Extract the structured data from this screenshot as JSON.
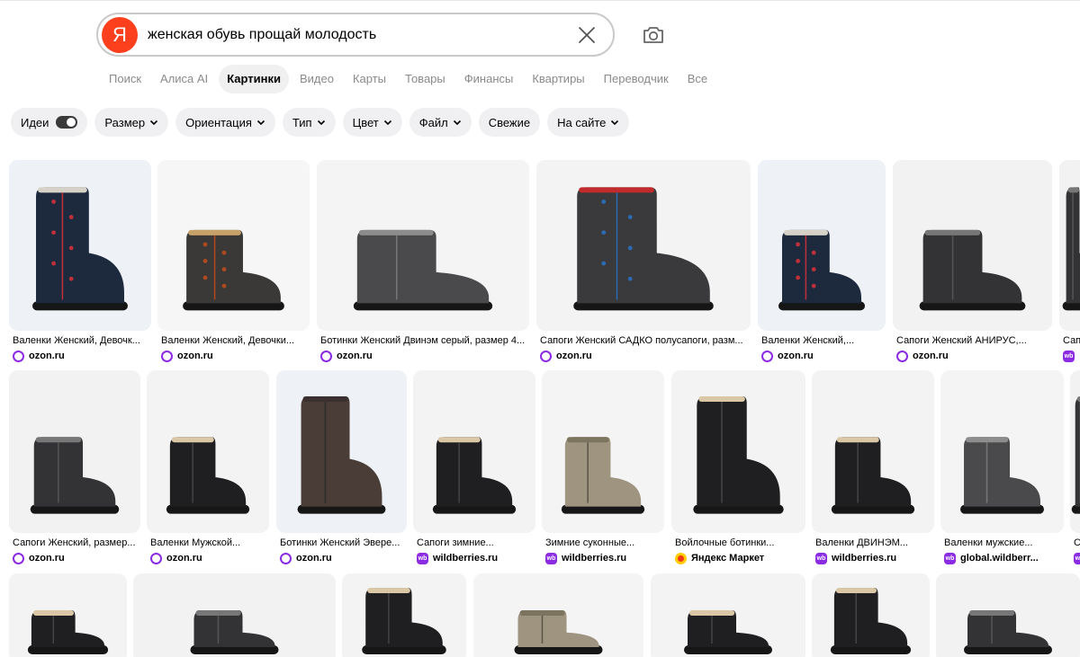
{
  "search": {
    "logo_letter": "Я",
    "query": "женская обувь прощай молодость"
  },
  "tabs": [
    {
      "label": "Поиск",
      "active": false
    },
    {
      "label": "Алиса AI",
      "active": false
    },
    {
      "label": "Картинки",
      "active": true
    },
    {
      "label": "Видео",
      "active": false
    },
    {
      "label": "Карты",
      "active": false
    },
    {
      "label": "Товары",
      "active": false
    },
    {
      "label": "Финансы",
      "active": false
    },
    {
      "label": "Квартиры",
      "active": false
    },
    {
      "label": "Переводчик",
      "active": false
    },
    {
      "label": "Все",
      "active": false
    }
  ],
  "filters": [
    {
      "label": "Идеи",
      "toggle": true,
      "on": true
    },
    {
      "label": "Размер",
      "dropdown": true
    },
    {
      "label": "Ориентация",
      "dropdown": true
    },
    {
      "label": "Тип",
      "dropdown": true
    },
    {
      "label": "Цвет",
      "dropdown": true
    },
    {
      "label": "Файл",
      "dropdown": true
    },
    {
      "label": "Свежие",
      "dropdown": false
    },
    {
      "label": "На сайте",
      "dropdown": true
    }
  ],
  "colors": {
    "logo": "#fc3f1d",
    "ozon": "#8b2be2",
    "wildberries": "#8b2be2",
    "market": "#ffcc00"
  },
  "results": [
    {
      "title": "Валенки Женский, Девочк...",
      "source": "ozon.ru",
      "source_icon": "ozon",
      "palette": "embroidered-blue"
    },
    {
      "title": "Валенки Женский, Девочки...",
      "source": "ozon.ru",
      "source_icon": "ozon",
      "palette": "patterned-gray"
    },
    {
      "title": "Ботинки Женский Двинэм серый, размер 4...",
      "source": "ozon.ru",
      "source_icon": "ozon",
      "palette": "felt-gray"
    },
    {
      "title": "Сапоги Женский САДКО полусапоги, разм...",
      "source": "ozon.ru",
      "source_icon": "ozon",
      "palette": "felt-red-trim"
    },
    {
      "title": "Валенки Женский,...",
      "source": "ozon.ru",
      "source_icon": "ozon",
      "palette": "embroidered-blue"
    },
    {
      "title": "Сапоги Женский АНИРУС,...",
      "source": "ozon.ru",
      "source_icon": "ozon",
      "palette": "felt-dark"
    },
    {
      "title": "Сап",
      "source": "",
      "source_icon": "wb",
      "palette": "felt-dark"
    },
    {
      "title": "Сапоги Женский, размер...",
      "source": "ozon.ru",
      "source_icon": "ozon",
      "palette": "felt-dark"
    },
    {
      "title": "Валенки Мужской...",
      "source": "ozon.ru",
      "source_icon": "ozon",
      "palette": "felt-black"
    },
    {
      "title": "Ботинки Женский Эвере...",
      "source": "ozon.ru",
      "source_icon": "ozon",
      "palette": "felt-brown"
    },
    {
      "title": "Сапоги зимние...",
      "source": "wildberries.ru",
      "source_icon": "wb",
      "palette": "felt-black"
    },
    {
      "title": "Зимние суконные...",
      "source": "wildberries.ru",
      "source_icon": "wb",
      "palette": "felt-beige"
    },
    {
      "title": "Войлочные ботинки...",
      "source": "Яндекс Маркет",
      "source_icon": "ym",
      "palette": "felt-black"
    },
    {
      "title": "Валенки ДВИНЭМ...",
      "source": "wildberries.ru",
      "source_icon": "wb",
      "palette": "felt-black"
    },
    {
      "title": "Валенки мужские...",
      "source": "global.wildberr...",
      "source_icon": "wb",
      "palette": "felt-gray"
    },
    {
      "title": "С",
      "source": "",
      "source_icon": "wb",
      "palette": "felt-dark"
    },
    {
      "title": "",
      "source": "",
      "source_icon": "",
      "palette": "felt-black"
    },
    {
      "title": "",
      "source": "",
      "source_icon": "",
      "palette": "felt-dark"
    },
    {
      "title": "",
      "source": "",
      "source_icon": "",
      "palette": "felt-black"
    },
    {
      "title": "",
      "source": "",
      "source_icon": "",
      "palette": "felt-beige"
    },
    {
      "title": "",
      "source": "",
      "source_icon": "",
      "palette": "felt-black"
    },
    {
      "title": "",
      "source": "",
      "source_icon": "",
      "palette": "felt-black"
    },
    {
      "title": "",
      "source": "",
      "source_icon": "",
      "palette": "felt-dark"
    }
  ]
}
